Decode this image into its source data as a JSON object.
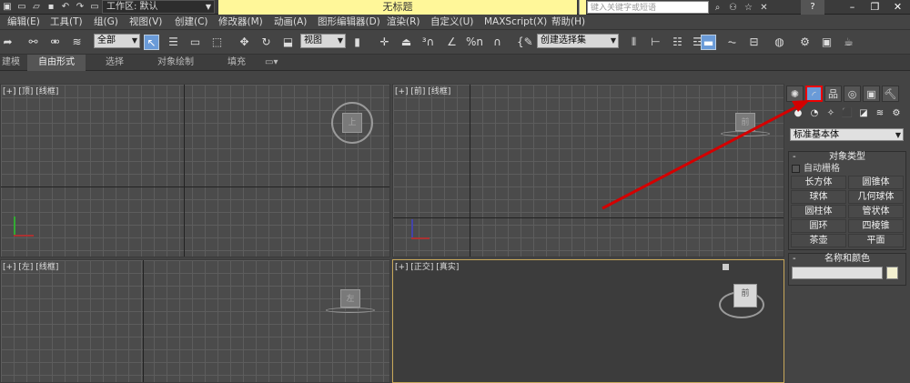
{
  "titlebar": {
    "workspace": "工作区: 默认",
    "title": "无标题",
    "search_placeholder": "键入关键字或短语",
    "help": "?"
  },
  "menu": [
    "编辑(E)",
    "工具(T)",
    "组(G)",
    "视图(V)",
    "创建(C)",
    "修改器(M)",
    "动画(A)",
    "图形编辑器(D)",
    "渲染(R)",
    "自定义(U)",
    "MAXScript(X)",
    "帮助(H)"
  ],
  "toolbar": {
    "filter": "全部",
    "ref_coord": "视图",
    "selection_set": "创建选择集",
    "snap_angle": "%n"
  },
  "ribbon": [
    "建模",
    "自由形式",
    "选择",
    "对象绘制",
    "填充"
  ],
  "viewports": {
    "top": "[+] [顶] [线框]",
    "front": "[+] [前] [线框]",
    "left": "[+] [左] [线框]",
    "persp": "[+] [正交] [真实]",
    "cube_top": "上",
    "cube_front": "前",
    "cube_left": "左",
    "cube_persp": "前"
  },
  "command_panel": {
    "category": "标准基本体",
    "object_type_title": "对象类型",
    "autogrid": "自动栅格",
    "buttons": [
      "长方体",
      "圆锥体",
      "球体",
      "几何球体",
      "圆柱体",
      "管状体",
      "圆环",
      "四棱锥",
      "茶壶",
      "平面"
    ],
    "name_color_title": "名称和颜色"
  },
  "colors": {
    "title_bg": "#fff799",
    "highlight": "#6a9bd8",
    "arrow": "#d40000",
    "active_viewport_border": "#c8a85a"
  }
}
